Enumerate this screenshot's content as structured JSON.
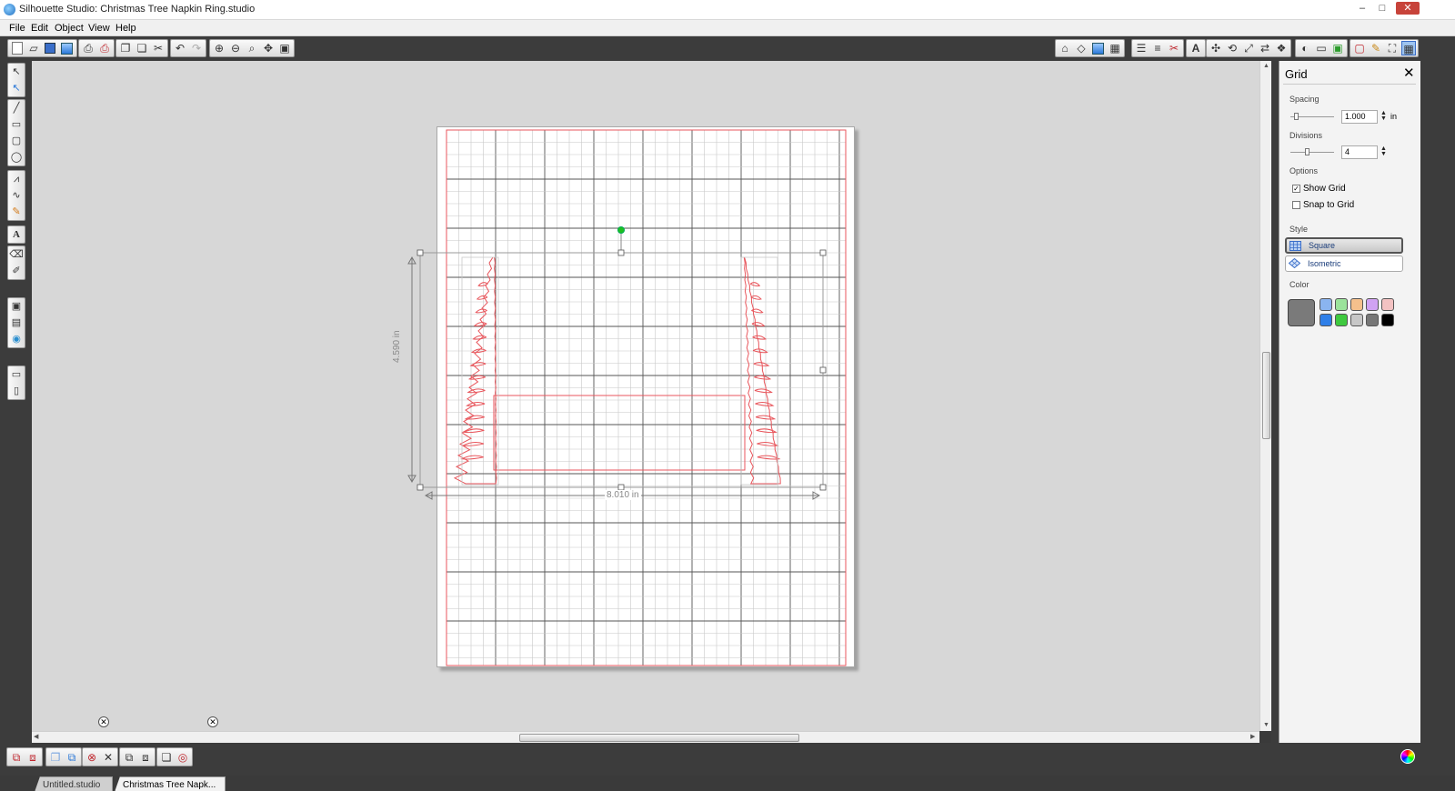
{
  "window": {
    "title": "Silhouette Studio: Christmas Tree Napkin Ring.studio",
    "controls": {
      "minimize": "–",
      "maximize": "□",
      "close": "✕"
    }
  },
  "menu": [
    "File",
    "Edit",
    "Object",
    "View",
    "Help"
  ],
  "tabs": [
    {
      "label": "Untitled.studio",
      "active": false
    },
    {
      "label": "Christmas Tree Napk...",
      "active": true
    }
  ],
  "design": {
    "height_label": "4.590 in",
    "width_label": "8.010 in",
    "line_color": "#e8565c",
    "grid_major_color": "#555555",
    "grid_minor_color": "#c8c8c8"
  },
  "grid_panel": {
    "title": "Grid",
    "spacing_label": "Spacing",
    "spacing_value": "1.000",
    "spacing_unit": "in",
    "divisions_label": "Divisions",
    "divisions_value": "4",
    "options_label": "Options",
    "show_grid_label": "Show Grid",
    "show_grid_checked": true,
    "snap_label": "Snap to Grid",
    "snap_checked": false,
    "style_label": "Style",
    "style_square": "Square",
    "style_isometric": "Isometric",
    "selected_style": "Square",
    "color_label": "Color",
    "selected_color": "#7a7a7a",
    "swatches": [
      "#8ab4f0",
      "#9be39b",
      "#f5c08c",
      "#d0a2f2",
      "#f3c2c2",
      "#2f7fe8",
      "#3fc93f",
      "#c7c7c7",
      "#777777",
      "#000000"
    ]
  }
}
